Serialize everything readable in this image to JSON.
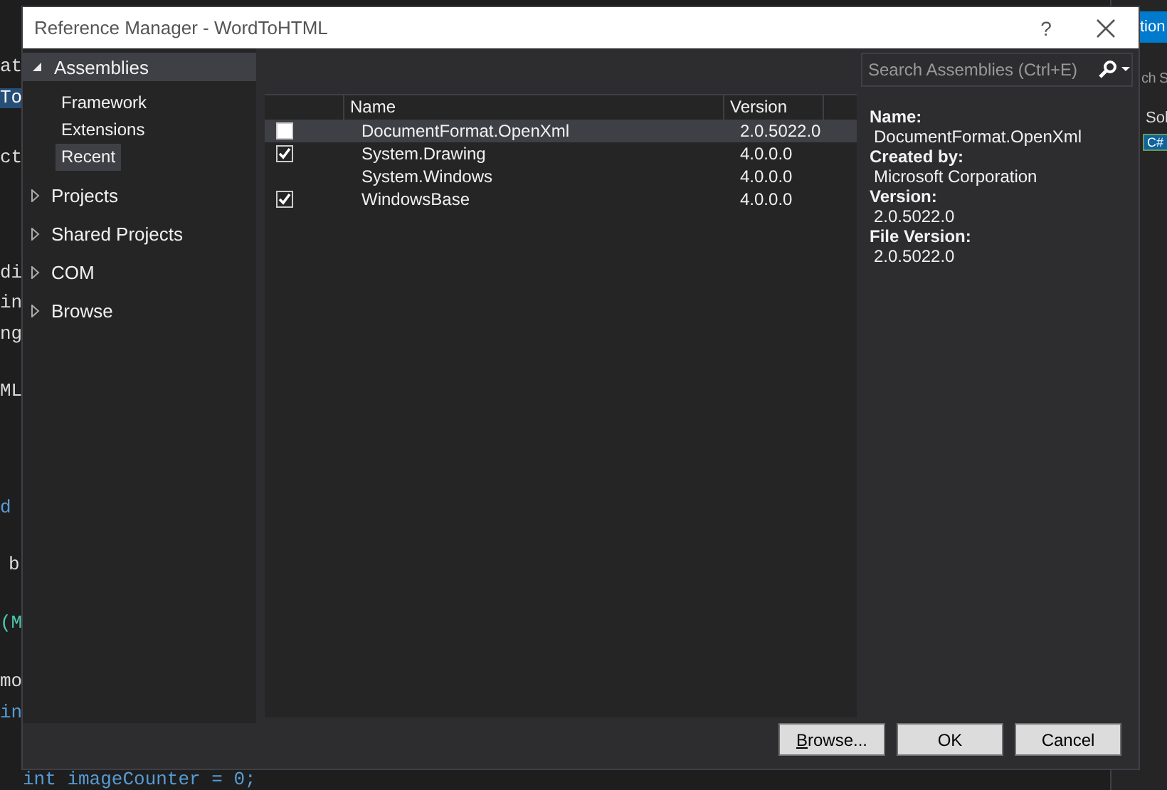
{
  "background_editor": {
    "lines": [
      {
        "text": "at",
        "selected": false
      },
      {
        "text": "To",
        "selected": true
      },
      {
        "text": "ct",
        "selected": false
      },
      {
        "text": "di",
        "selected": false
      },
      {
        "text": "in",
        "selected": false
      },
      {
        "text": "ng",
        "selected": false
      },
      {
        "text": "ML",
        "selected": false
      },
      {
        "text": "d",
        "selected": false
      },
      {
        "text": "b",
        "selected": false
      },
      {
        "text": "(M",
        "selected": false
      },
      {
        "text": "mo",
        "selected": false
      },
      {
        "text": "in",
        "selected": false
      },
      {
        "text": "int imageCounter = 0;",
        "selected": false
      }
    ]
  },
  "background_panel": {
    "title": "tion",
    "search": "ch S",
    "label": "Sol",
    "badge": "C#"
  },
  "window": {
    "title": "Reference Manager - WordToHTML",
    "help": "?"
  },
  "tree": [
    {
      "label": "Assemblies",
      "expanded": true,
      "children": [
        {
          "label": "Framework",
          "selected": false
        },
        {
          "label": "Extensions",
          "selected": false
        },
        {
          "label": "Recent",
          "selected": true
        }
      ]
    },
    {
      "label": "Projects",
      "expanded": false
    },
    {
      "label": "Shared Projects",
      "expanded": false
    },
    {
      "label": "COM",
      "expanded": false
    },
    {
      "label": "Browse",
      "expanded": false
    }
  ],
  "search": {
    "placeholder": "Search Assemblies (Ctrl+E)"
  },
  "table": {
    "columns": [
      "Name",
      "Version"
    ],
    "rows": [
      {
        "has_checkbox": true,
        "checked": false,
        "selected": true,
        "name": "DocumentFormat.OpenXml",
        "version": "2.0.5022.0"
      },
      {
        "has_checkbox": true,
        "checked": true,
        "selected": false,
        "name": "System.Drawing",
        "version": "4.0.0.0"
      },
      {
        "has_checkbox": false,
        "selected": false,
        "name": "System.Windows",
        "version": "4.0.0.0"
      },
      {
        "has_checkbox": true,
        "checked": true,
        "selected": false,
        "name": "WindowsBase",
        "version": "4.0.0.0"
      }
    ]
  },
  "details": [
    {
      "label": "Name:",
      "value": "DocumentFormat.OpenXml"
    },
    {
      "label": "Created by:",
      "value": "Microsoft Corporation"
    },
    {
      "label": "Version:",
      "value": "2.0.5022.0"
    },
    {
      "label": "File Version:",
      "value": "2.0.5022.0"
    }
  ],
  "buttons": [
    {
      "label": "Browse...",
      "mnemonic": true
    },
    {
      "label": "OK",
      "mnemonic": false
    },
    {
      "label": "Cancel",
      "mnemonic": false
    }
  ]
}
